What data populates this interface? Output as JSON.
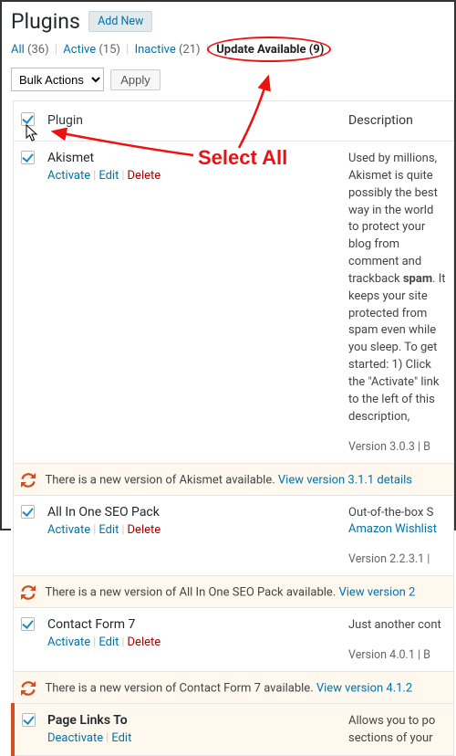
{
  "header": {
    "title": "Plugins",
    "add_new": "Add New"
  },
  "filters": {
    "all_label": "All",
    "all_count": "(36)",
    "active_label": "Active",
    "active_count": "(15)",
    "inactive_label": "Inactive",
    "inactive_count": "(21)",
    "update_label": "Update Available",
    "update_count": "(9)"
  },
  "bulk": {
    "select_label": "Bulk Actions",
    "apply_label": "Apply"
  },
  "table": {
    "col_plugin": "Plugin",
    "col_desc": "Description"
  },
  "rows": [
    {
      "name": "Akismet",
      "action1": "Activate",
      "action2": "Edit",
      "action3": "Delete",
      "desc": "Used by millions, Akismet is quite possibly the best way in the world to protect your blog from comment and trackback",
      "desc_strong": "spam",
      "desc_tail": ". It keeps your site protected from spam even while you sleep. To get started: 1) Click the \"Activate\" link to the left of this description,",
      "version": "Version 3.0.3 | B",
      "update_pre": "There is a new version of Akismet available. ",
      "update_link": "View version 3.1.1 details"
    },
    {
      "name": "All In One SEO Pack",
      "action1": "Activate",
      "action2": "Edit",
      "action3": "Delete",
      "desc": "Out-of-the-box S",
      "desc_link": "Amazon Wishlist",
      "version": "Version 2.2.3.1 |",
      "update_pre": "There is a new version of All In One SEO Pack available. ",
      "update_link": "View version 2"
    },
    {
      "name": "Contact Form 7",
      "action1": "Activate",
      "action2": "Edit",
      "action3": "Delete",
      "desc": "Just another cont",
      "version": "Version 4.0.1 | B",
      "update_pre": "There is a new version of Contact Form 7 available. ",
      "update_link": "View version 4.1.2"
    },
    {
      "name": "Page Links To",
      "action1": "Deactivate",
      "action2": "Edit",
      "desc": "Allows you to po",
      "desc2": "sections of your"
    }
  ],
  "annotation": {
    "select_all": "Select All"
  },
  "icons": {
    "refresh": "refresh-icon",
    "cursor": "cursor-icon"
  }
}
